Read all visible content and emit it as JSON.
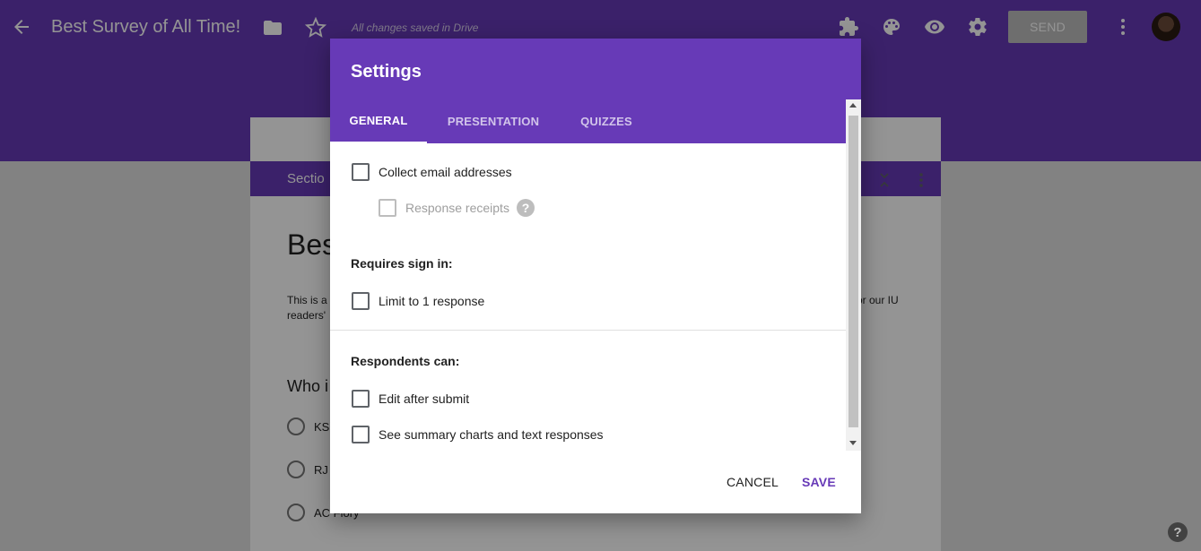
{
  "colors": {
    "brand": "#673ab7",
    "scrim": "rgba(0,0,0,0.42)"
  },
  "topbar": {
    "title": "Best Survey of All Time!",
    "save_status": "All changes saved in Drive",
    "send_label": "SEND",
    "icons": [
      "back-arrow-icon",
      "folder-icon",
      "star-icon",
      "addons-puzzle-icon",
      "palette-icon",
      "preview-eye-icon",
      "settings-gear-icon",
      "more-vert-icon"
    ]
  },
  "form": {
    "section_label": "Sectio",
    "title": "Bes",
    "description_line1": "This is a",
    "description_line2": "readers'",
    "description_end": "or our IU",
    "question_title": "Who i",
    "options": [
      "KS",
      "RJ",
      "AC Flory"
    ]
  },
  "dialog": {
    "title": "Settings",
    "tabs": [
      {
        "label": "GENERAL",
        "selected": true
      },
      {
        "label": "PRESENTATION",
        "selected": false
      },
      {
        "label": "QUIZZES",
        "selected": false
      }
    ],
    "general": {
      "collect_email": {
        "label": "Collect email addresses",
        "checked": false
      },
      "response_receipts": {
        "label": "Response receipts",
        "checked": false,
        "disabled": true
      },
      "requires_sign_in": "Requires sign in:",
      "limit_one": {
        "label": "Limit to 1 response",
        "checked": false
      },
      "respondents_can": "Respondents can:",
      "edit_after_submit": {
        "label": "Edit after submit",
        "checked": false
      },
      "see_summary": {
        "label": "See summary charts and text responses",
        "checked": false
      }
    },
    "cancel_label": "CANCEL",
    "save_label": "SAVE"
  },
  "help_fab": "?"
}
